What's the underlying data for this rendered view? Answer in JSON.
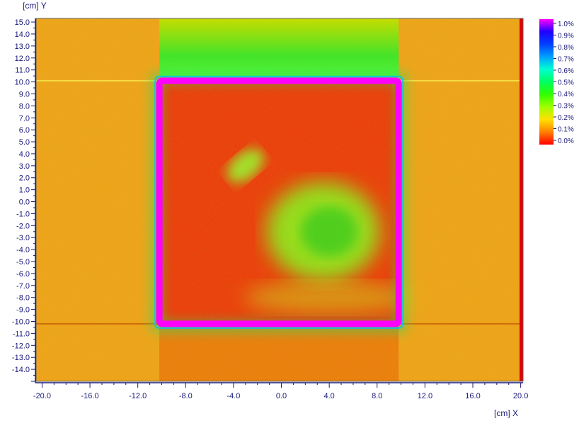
{
  "chart_data": {
    "type": "heatmap",
    "title": "",
    "xlabel": "[cm] X",
    "ylabel": "[cm] Y",
    "xlim": [
      -20.5,
      20.2
    ],
    "ylim": [
      -15.0,
      15.3
    ],
    "x_ticks": [
      "-20.0",
      "-16.0",
      "-12.0",
      "-8.0",
      "-4.0",
      "0.0",
      "4.0",
      "8.0",
      "12.0",
      "16.0",
      "20.0"
    ],
    "y_ticks": [
      "15.0",
      "14.0",
      "13.0",
      "12.0",
      "11.0",
      "10.0",
      "9.0",
      "8.0",
      "7.0",
      "6.0",
      "5.0",
      "4.0",
      "3.0",
      "2.0",
      "1.0",
      "0.0",
      "-1.0",
      "-2.0",
      "-3.0",
      "-4.0",
      "-5.0",
      "-6.0",
      "-7.0",
      "-8.0",
      "-9.0",
      "-10.0",
      "-11.0",
      "-12.0",
      "-13.0",
      "-14.0"
    ],
    "colorbar": {
      "labels": [
        "1.0%",
        "0.9%",
        "0.8%",
        "0.7%",
        "0.6%",
        "0.5%",
        "0.4%",
        "0.3%",
        "0.2%",
        "0.1%",
        "0.0%"
      ],
      "colors": [
        "#ff00ff",
        "#2000ff",
        "#0040ff",
        "#00a0ff",
        "#00ffd0",
        "#00ff60",
        "#30ff00",
        "#a0ff00",
        "#ffe000",
        "#ff8000",
        "#ff0000"
      ]
    },
    "regions": [
      {
        "name": "background field",
        "value": 0.12
      },
      {
        "name": "band above square",
        "value": 0.35
      },
      {
        "name": "square edge",
        "value": 1.0
      },
      {
        "name": "square interior",
        "value": 0.08
      },
      {
        "name": "interior hot region",
        "value": 0.35
      }
    ],
    "square": {
      "x": [
        -10.2,
        9.8
      ],
      "y": [
        -10.2,
        10.1
      ]
    }
  }
}
